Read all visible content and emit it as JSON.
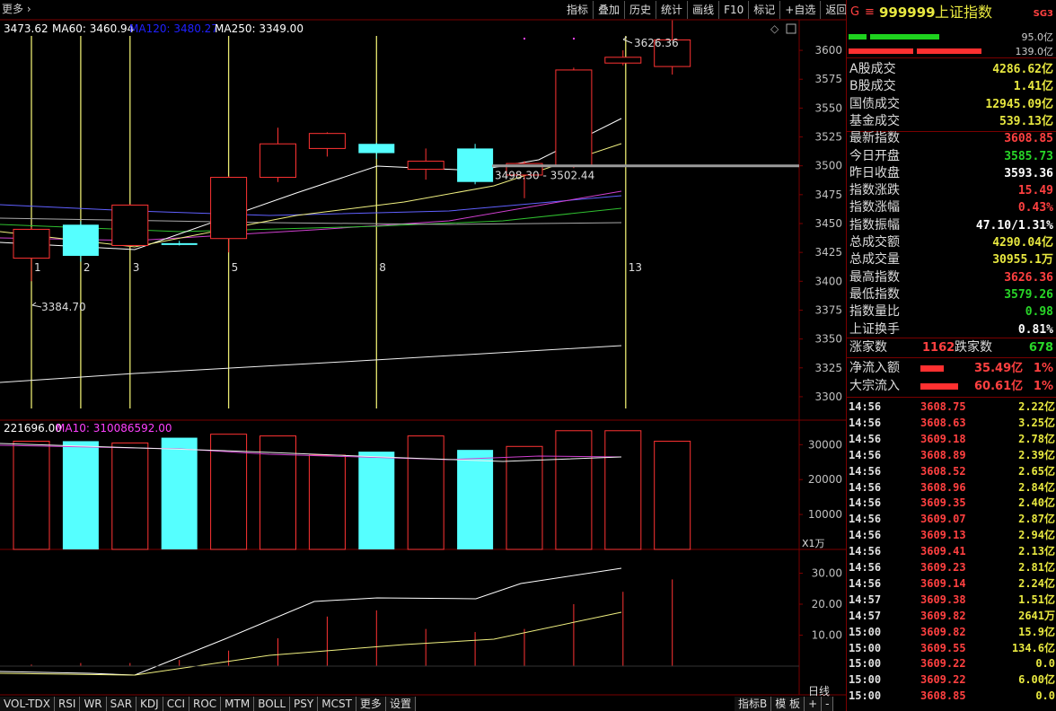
{
  "header": {
    "more_label": "更多",
    "ma_legend": [
      {
        "text": "3473.62",
        "color": "#ffffff"
      },
      {
        "text": "MA60: 3460.94",
        "color": "#ffffff"
      },
      {
        "text": "MA120: 3480.27",
        "color": "#2020ff"
      },
      {
        "text": "MA250: 3349.00",
        "color": "#ffffff"
      }
    ]
  },
  "toolbar": [
    "指标",
    "叠加",
    "历史",
    "统计",
    "画线",
    "F10",
    "标记",
    "+自选",
    "返回"
  ],
  "kline": {
    "y_ticks": [
      "3600",
      "3575",
      "3550",
      "3525",
      "3500",
      "3475",
      "3450",
      "3425",
      "3400",
      "3375",
      "3350",
      "3325",
      "3300"
    ],
    "candles": [
      {
        "open": 3420,
        "close": 3445,
        "high": 3447,
        "low": 3400
      },
      {
        "open": 3449,
        "close": 3422,
        "high": 3452,
        "low": 3417
      },
      {
        "open": 3431,
        "close": 3466,
        "high": 3467,
        "low": 3430
      },
      {
        "open": 3433,
        "close": 3432,
        "high": 3435,
        "low": 3431
      },
      {
        "open": 3437,
        "close": 3490,
        "high": 3491,
        "low": 3425
      },
      {
        "open": 3490,
        "close": 3519,
        "high": 3533,
        "low": 3486
      },
      {
        "open": 3515,
        "close": 3528,
        "high": 3529,
        "low": 3508
      },
      {
        "open": 3519,
        "close": 3511,
        "high": 3520,
        "low": 3506
      },
      {
        "open": 3497,
        "close": 3504,
        "high": 3515,
        "low": 3488
      },
      {
        "open": 3515,
        "close": 3486,
        "high": 3519,
        "low": 3484
      },
      {
        "open": 3492,
        "close": 3502,
        "high": 3504,
        "low": 3472
      },
      {
        "open": 3500,
        "close": 3583,
        "high": 3585,
        "low": 3498
      },
      {
        "open": 3589,
        "close": 3594,
        "high": 3600,
        "low": 3587
      },
      {
        "open": 3586,
        "close": 3609,
        "high": 3626,
        "low": 3579
      }
    ],
    "annotations": {
      "high_label": "3626.36",
      "low_label": "3384.70",
      "range_label": "3498.30 - 3502.44"
    },
    "day_markers": [
      "1",
      "2",
      "3",
      "5",
      "8",
      "13"
    ]
  },
  "volume": {
    "legend": [
      {
        "text": "221696.00",
        "color": "#ffffff"
      },
      {
        "text": "MA10: 310086592.00",
        "color": "#ff40ff"
      }
    ],
    "y_ticks": [
      "30000",
      "20000",
      "10000"
    ],
    "unit_label": "X1万",
    "bars": [
      31000,
      31000,
      30500,
      32000,
      33000,
      32500,
      27000,
      28000,
      32500,
      28500,
      29500,
      34000,
      34000,
      31000
    ]
  },
  "indicator": {
    "y_ticks": [
      "30.00",
      "20.00",
      "10.00"
    ]
  },
  "bottom_tabs": [
    "VOL-TDX",
    "RSI",
    "WR",
    "SAR",
    "KDJ",
    "CCI",
    "ROC",
    "MTM",
    "BOLL",
    "PSY",
    "MCST",
    "更多",
    "设置"
  ],
  "bottom_right": [
    "指标B",
    "模 板",
    "+",
    "-"
  ],
  "period_label": "日线",
  "sidebar": {
    "title_prefix": "G",
    "title_code": "999999",
    "title_name": "上证指数",
    "badge": "SG3",
    "bar1_label": "95.0亿",
    "bar2_label": "139.0亿",
    "rows": [
      {
        "label": "A股成交",
        "value": "4286.62亿",
        "color": "#e8e840"
      },
      {
        "label": "B股成交",
        "value": "1.41亿",
        "color": "#e8e840"
      },
      {
        "label": "国债成交",
        "value": "12945.09亿",
        "color": "#e8e840"
      },
      {
        "label": "基金成交",
        "value": "539.13亿",
        "color": "#e8e840"
      },
      {
        "label": "最新指数",
        "value": "3608.85",
        "color": "#ff4040"
      },
      {
        "label": "今日开盘",
        "value": "3585.73",
        "color": "#28d628"
      },
      {
        "label": "昨日收盘",
        "value": "3593.36",
        "color": "#ffffff"
      },
      {
        "label": "指数涨跌",
        "value": "15.49",
        "color": "#ff4040"
      },
      {
        "label": "指数涨幅",
        "value": "0.43%",
        "color": "#ff4040"
      },
      {
        "label": "指数振幅",
        "value": "47.10/1.31%",
        "color": "#ffffff"
      },
      {
        "label": "总成交额",
        "value": "4290.04亿",
        "color": "#e8e840"
      },
      {
        "label": "总成交量",
        "value": "30955.1万",
        "color": "#e8e840"
      },
      {
        "label": "最高指数",
        "value": "3626.36",
        "color": "#ff4040"
      },
      {
        "label": "最低指数",
        "value": "3579.26",
        "color": "#28d628"
      },
      {
        "label": "指数量比",
        "value": "0.98",
        "color": "#28d628"
      },
      {
        "label": "上证换手",
        "value": "0.81%",
        "color": "#ffffff"
      }
    ],
    "rise_label": "涨家数",
    "rise_value": "1162",
    "fall_label": "跌家数",
    "fall_value": "678",
    "flows": [
      {
        "label": "净流入额",
        "value": "35.49亿",
        "pct": "1%"
      },
      {
        "label": "大宗流入",
        "value": "60.61亿",
        "pct": "1%"
      }
    ],
    "ticks": [
      {
        "time": "14:56",
        "price": "3608.75",
        "vol": "2.22亿"
      },
      {
        "time": "14:56",
        "price": "3608.63",
        "vol": "3.25亿"
      },
      {
        "time": "14:56",
        "price": "3609.18",
        "vol": "2.78亿"
      },
      {
        "time": "14:56",
        "price": "3608.89",
        "vol": "2.39亿"
      },
      {
        "time": "14:56",
        "price": "3608.52",
        "vol": "2.65亿"
      },
      {
        "time": "14:56",
        "price": "3608.96",
        "vol": "2.84亿"
      },
      {
        "time": "14:56",
        "price": "3609.35",
        "vol": "2.40亿"
      },
      {
        "time": "14:56",
        "price": "3609.07",
        "vol": "2.87亿"
      },
      {
        "time": "14:56",
        "price": "3609.13",
        "vol": "2.94亿"
      },
      {
        "time": "14:56",
        "price": "3609.41",
        "vol": "2.13亿"
      },
      {
        "time": "14:56",
        "price": "3609.23",
        "vol": "2.81亿"
      },
      {
        "time": "14:56",
        "price": "3609.14",
        "vol": "2.24亿"
      },
      {
        "time": "14:57",
        "price": "3609.38",
        "vol": "1.51亿"
      },
      {
        "time": "14:57",
        "price": "3609.82",
        "vol": "2641万"
      },
      {
        "time": "15:00",
        "price": "3609.82",
        "vol": "15.9亿"
      },
      {
        "time": "15:00",
        "price": "3609.55",
        "vol": "134.6亿"
      },
      {
        "time": "15:00",
        "price": "3609.22",
        "vol": "0.0"
      },
      {
        "time": "15:00",
        "price": "3609.22",
        "vol": "6.00亿"
      },
      {
        "time": "15:00",
        "price": "3608.85",
        "vol": "0.0"
      }
    ],
    "colors": {
      "price_up": "#ff4040",
      "time": "#e0e0e0"
    }
  }
}
